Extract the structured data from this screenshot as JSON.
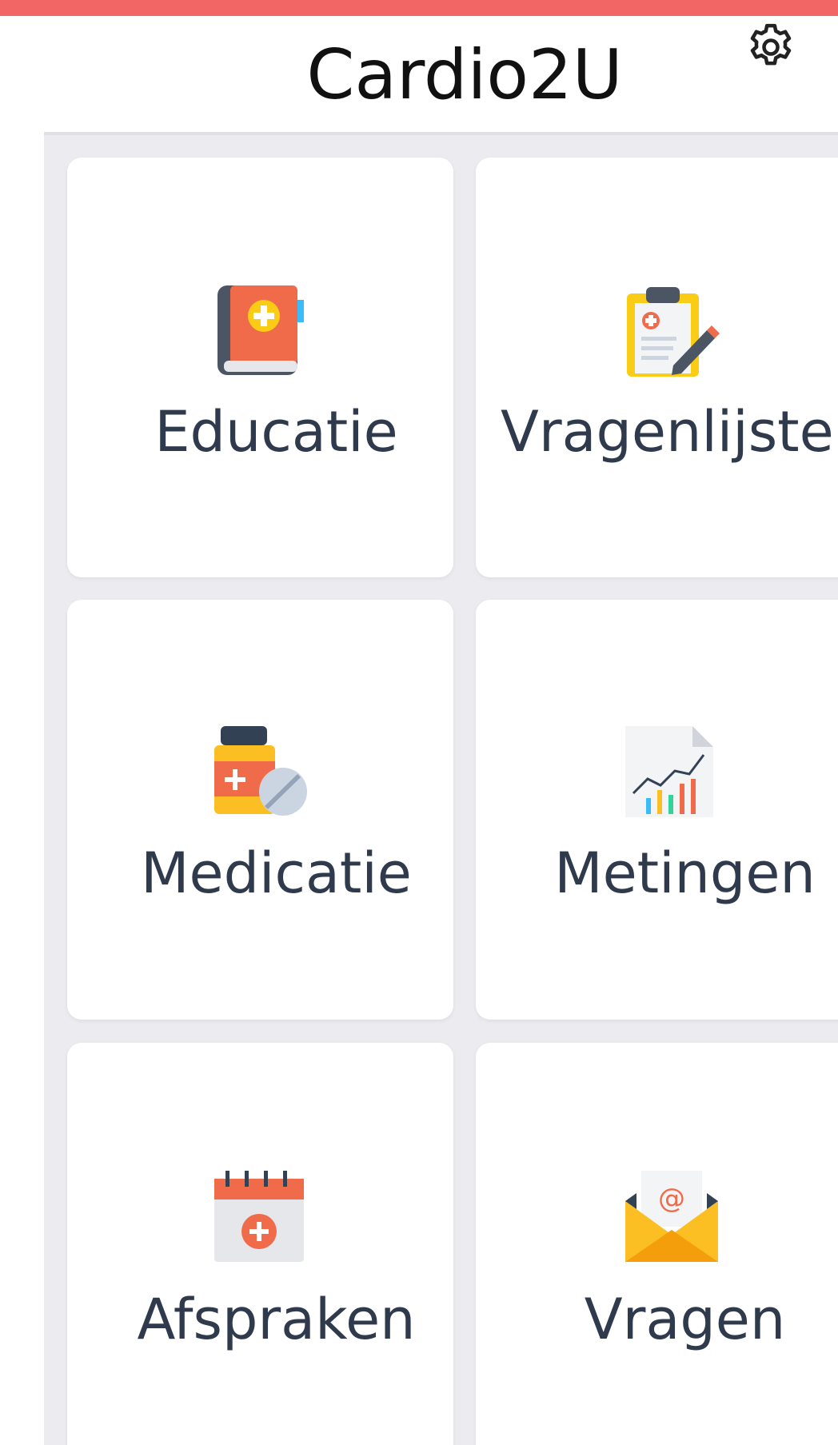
{
  "app": {
    "title": "Cardio2U",
    "settings_icon": "gear-icon"
  },
  "tiles": [
    {
      "label": "Educatie",
      "icon": "medical-book-icon"
    },
    {
      "label": "Vragenlijsten",
      "icon": "clipboard-pencil-icon"
    },
    {
      "label": "Medicatie",
      "icon": "medicine-bottle-pill-icon"
    },
    {
      "label": "Metingen",
      "icon": "chart-report-icon"
    },
    {
      "label": "Afspraken",
      "icon": "calendar-plus-icon"
    },
    {
      "label": "Vragen",
      "icon": "email-envelope-icon"
    }
  ],
  "colors": {
    "top_bar": "#f26666",
    "background": "#ececf0",
    "card": "#ffffff",
    "label_text": "#2f3a4c"
  }
}
